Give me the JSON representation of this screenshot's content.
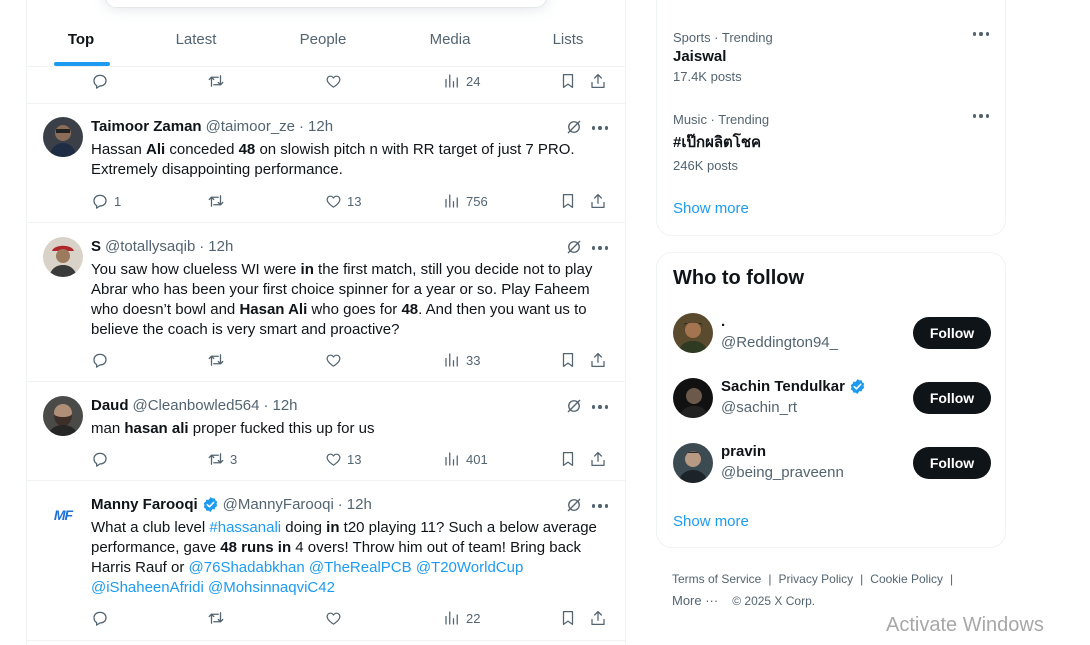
{
  "tabs": [
    "Top",
    "Latest",
    "People",
    "Media",
    "Lists"
  ],
  "top_tweet_actions": {
    "views": "24"
  },
  "tweets": [
    {
      "name": "Taimoor Zaman",
      "handle": "@taimoor_ze",
      "time": "12h",
      "verified": false,
      "body_segments": [
        {
          "t": "Hassan "
        },
        {
          "t": "Ali",
          "b": true
        },
        {
          "t": " conceded "
        },
        {
          "t": "48",
          "b": true
        },
        {
          "t": " on slowish pitch n with RR target of just 7 PRO. Extremely disappointing performance."
        }
      ],
      "replies": "1",
      "reposts": "",
      "likes": "13",
      "views": "756"
    },
    {
      "name": "S",
      "handle": "@totallysaqib",
      "time": "12h",
      "verified": false,
      "body_segments": [
        {
          "t": "You saw how clueless WI were "
        },
        {
          "t": "in",
          "b": true
        },
        {
          "t": " the first match, still you decide not to play Abrar who has been your first choice spinner for a year or so. Play Faheem who doesn’t bowl and "
        },
        {
          "t": "Hasan Ali",
          "b": true
        },
        {
          "t": " who goes for "
        },
        {
          "t": "48",
          "b": true
        },
        {
          "t": ". And then you want us to believe the coach is very smart and proactive?"
        }
      ],
      "replies": "",
      "reposts": "",
      "likes": "",
      "views": "33"
    },
    {
      "name": "Daud",
      "handle": "@Cleanbowled564",
      "time": "12h",
      "verified": false,
      "body_segments": [
        {
          "t": "man "
        },
        {
          "t": "hasan ali",
          "b": true
        },
        {
          "t": " proper fucked this up for us"
        }
      ],
      "replies": "",
      "reposts": "3",
      "likes": "13",
      "views": "401"
    },
    {
      "name": "Manny Farooqi",
      "handle": "@MannyFarooqi",
      "time": "12h",
      "verified": true,
      "avatar_text": "MF",
      "body_segments": [
        {
          "t": "What a club level "
        },
        {
          "t": "#hassanali",
          "l": true
        },
        {
          "t": " doing "
        },
        {
          "t": "in",
          "b": true
        },
        {
          "t": " t20 playing 11? Such a below average performance, gave "
        },
        {
          "t": "48 runs in",
          "b": true
        },
        {
          "t": " 4 overs! Throw him out of team! Bring back Harris Rauf or "
        },
        {
          "t": "@76Shadabkhan",
          "l": true
        },
        {
          "t": " "
        },
        {
          "t": "@TheRealPCB",
          "l": true
        },
        {
          "t": " "
        },
        {
          "t": "@T20WorldCup",
          "l": true
        },
        {
          "t": " "
        },
        {
          "t": "@iShaheenAfridi",
          "l": true
        },
        {
          "t": " "
        },
        {
          "t": "@MohsinnaqviC42",
          "l": true
        }
      ],
      "replies": "",
      "reposts": "",
      "likes": "",
      "views": "22"
    }
  ],
  "trends": [
    {
      "meta": "Sports · Trending",
      "topic": "Jaiswal",
      "posts": "17.4K posts"
    },
    {
      "meta": "Music · Trending",
      "topic": "#เป๊กผลิตโชค",
      "posts": "246K posts"
    }
  ],
  "trends_show_more": "Show more",
  "who_to_follow": {
    "title": "Who to follow",
    "users": [
      {
        "name": ".",
        "handle": "@Reddington94_",
        "verified": false,
        "button": "Follow"
      },
      {
        "name": "Sachin Tendulkar",
        "handle": "@sachin_rt",
        "verified": true,
        "button": "Follow"
      },
      {
        "name": "pravin",
        "handle": "@being_praveenn",
        "verified": false,
        "button": "Follow"
      }
    ],
    "show_more": "Show more"
  },
  "footer": {
    "links": [
      "Terms of Service",
      "Privacy Policy",
      "Cookie Policy"
    ],
    "more": "More ···",
    "copyright": "© 2025 X Corp."
  },
  "watermark": "Activate Windows",
  "colors": {
    "accent": "#1d9bf0",
    "text": "#0f1419",
    "muted": "#536471",
    "button": "#0f1419"
  }
}
